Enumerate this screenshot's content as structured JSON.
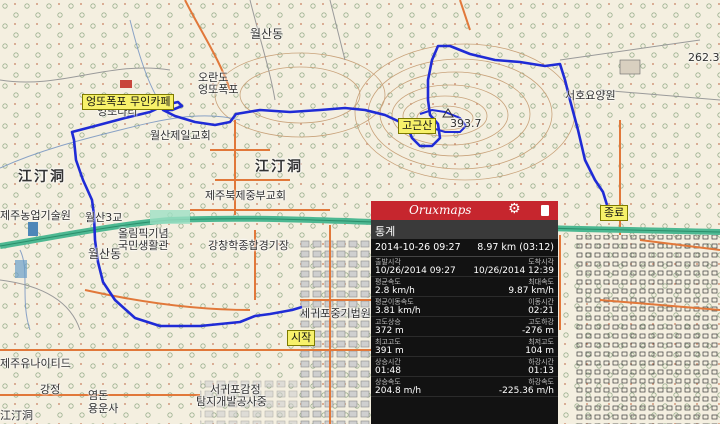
{
  "map": {
    "tags": {
      "start": "시작",
      "end": "종료",
      "peak": "고근산",
      "cafe": "엉또폭포 무인카페"
    },
    "labels": {
      "wolsan_dong_n": "월산동",
      "wolsan_dong_w": "월산동",
      "gangjeong_left": "江汀洞",
      "gangjeong_mid": "江汀洞",
      "otdo_bridge": "엉또다리",
      "ottdo_falls": "엉또폭포",
      "oranmo": "오란도",
      "church_wolsan": "월산제일교회",
      "church_jeju": "제주북제중부교회",
      "wolsan3": "월산3교",
      "agri": "제주농업기술원",
      "olympic": "올림픽기념",
      "gukmin": "국민생활관",
      "kangchang": "강창학종합경기장",
      "seoho_reservoir": "서호요양원",
      "elev_peak": "393.7",
      "elev_ne": "262.3",
      "jeju_unitedcity": "제주유나이티드",
      "gangjeong_bottom": "강정",
      "yeomdon": "염돈",
      "yongeunsa": "용운사",
      "seogwi_office": "서귀포감정",
      "taeji": "탐지개발공사중",
      "gangjeong_mark": "江汀洞",
      "sikdong": "세귀포중기법원"
    }
  },
  "panel": {
    "logo": "Oruxmaps",
    "title": "통계",
    "trip_date": "2014-10-26 09:27",
    "trip_dist": "8.97 km (03:12)",
    "stats": [
      {
        "left_k": "출발시각",
        "left_v": "10/26/2014 09:27",
        "right_k": "도착시각",
        "right_v": "10/26/2014 12:39"
      },
      {
        "left_k": "평균속도",
        "left_v": "2.8 km/h",
        "right_k": "최대속도",
        "right_v": "9.87 km/h"
      },
      {
        "left_k": "평균이동속도",
        "left_v": "3.81 km/h",
        "right_k": "이동시간",
        "right_v": "02:21"
      },
      {
        "left_k": "고도상승",
        "left_v": "372 m",
        "right_k": "고도하강",
        "right_v": "-276 m"
      },
      {
        "left_k": "최고고도",
        "left_v": "391 m",
        "right_k": "최저고도",
        "right_v": "104 m"
      },
      {
        "left_k": "상승시간",
        "left_v": "01:48",
        "right_k": "하강시간",
        "right_v": "01:13"
      },
      {
        "left_k": "상승속도",
        "left_v": "204.8 m/h",
        "right_k": "하강속도",
        "right_v": "-225.36 m/h"
      }
    ]
  },
  "colors": {
    "track": "#1f2bd6",
    "highway": "#2aa47b",
    "road": "#e1783a",
    "panel_header": "#c6262e"
  }
}
